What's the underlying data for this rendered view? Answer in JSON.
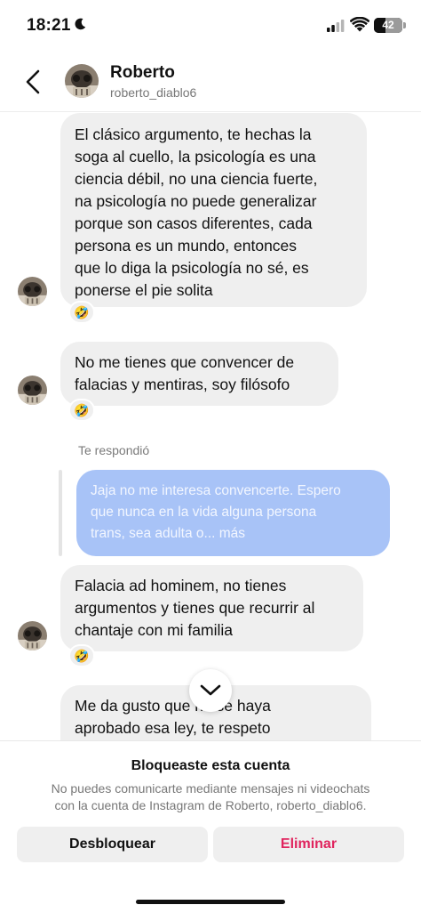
{
  "status_bar": {
    "time": "18:21",
    "battery_level": "42",
    "battery_fraction": 0.42,
    "icons": [
      "moon-icon",
      "signal-icon",
      "wifi-icon",
      "battery-icon"
    ]
  },
  "header": {
    "name": "Roberto",
    "username": "roberto_diablo6",
    "back_icon": "chevron-left-icon"
  },
  "messages": [
    {
      "sender": "Roberto",
      "lines": [
        "El clásico argumento, te hechas la",
        "soga al cuello, la psicología es una",
        "ciencia débil, no una ciencia fuerte,",
        "na psicología no puede generalizar",
        "porque son casos diferentes, cada",
        "persona es un mundo, entonces",
        "que lo diga la psicología no sé, es",
        "ponerse el pie solita"
      ],
      "reaction": "🤣"
    },
    {
      "sender": "Roberto",
      "lines": [
        "No me tienes que convencer de",
        "falacias y mentiras, soy filósofo"
      ],
      "reaction": "🤣"
    },
    {
      "sender": "Roberto",
      "reply_label": "Te respondió",
      "quoted_lines": [
        "Jaja no me interesa convencerte. Espero",
        "que nunca en la vida alguna persona",
        "trans, sea adulta o... más"
      ],
      "lines": [
        "Falacia ad hominem, no tienes",
        "argumentos y tienes que recurrir al",
        "chantaje con mi familia"
      ],
      "reaction": "🤣"
    },
    {
      "sender": "Roberto",
      "lines": [
        "Me da gusto que no se haya",
        "aprobado esa ley, te respeto"
      ]
    }
  ],
  "scroll_button_icon": "chevron-down-icon",
  "blocked_panel": {
    "title": "Bloqueaste esta cuenta",
    "description_lines": [
      "No puedes comunicarte mediante mensajes ni videochats",
      "con la cuenta de Instagram de Roberto, roberto_diablo6."
    ],
    "unblock_label": "Desbloquear",
    "delete_label": "Eliminar"
  },
  "colors": {
    "received_bubble": "#efefef",
    "quoted_bubble": "#a8c3f7",
    "delete_text": "#e0245e"
  }
}
